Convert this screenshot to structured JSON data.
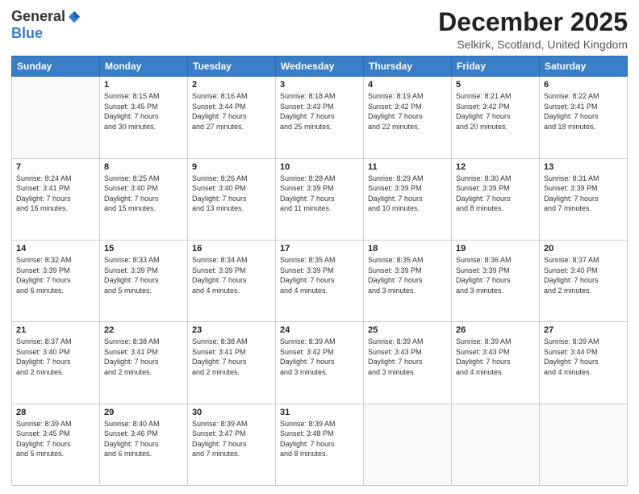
{
  "logo": {
    "general": "General",
    "blue": "Blue"
  },
  "header": {
    "month": "December 2025",
    "location": "Selkirk, Scotland, United Kingdom"
  },
  "weekdays": [
    "Sunday",
    "Monday",
    "Tuesday",
    "Wednesday",
    "Thursday",
    "Friday",
    "Saturday"
  ],
  "weeks": [
    [
      {
        "day": "",
        "info": ""
      },
      {
        "day": "1",
        "info": "Sunrise: 8:15 AM\nSunset: 3:45 PM\nDaylight: 7 hours\nand 30 minutes."
      },
      {
        "day": "2",
        "info": "Sunrise: 8:16 AM\nSunset: 3:44 PM\nDaylight: 7 hours\nand 27 minutes."
      },
      {
        "day": "3",
        "info": "Sunrise: 8:18 AM\nSunset: 3:43 PM\nDaylight: 7 hours\nand 25 minutes."
      },
      {
        "day": "4",
        "info": "Sunrise: 8:19 AM\nSunset: 3:42 PM\nDaylight: 7 hours\nand 22 minutes."
      },
      {
        "day": "5",
        "info": "Sunrise: 8:21 AM\nSunset: 3:42 PM\nDaylight: 7 hours\nand 20 minutes."
      },
      {
        "day": "6",
        "info": "Sunrise: 8:22 AM\nSunset: 3:41 PM\nDaylight: 7 hours\nand 18 minutes."
      }
    ],
    [
      {
        "day": "7",
        "info": "Sunrise: 8:24 AM\nSunset: 3:41 PM\nDaylight: 7 hours\nand 16 minutes."
      },
      {
        "day": "8",
        "info": "Sunrise: 8:25 AM\nSunset: 3:40 PM\nDaylight: 7 hours\nand 15 minutes."
      },
      {
        "day": "9",
        "info": "Sunrise: 8:26 AM\nSunset: 3:40 PM\nDaylight: 7 hours\nand 13 minutes."
      },
      {
        "day": "10",
        "info": "Sunrise: 8:28 AM\nSunset: 3:39 PM\nDaylight: 7 hours\nand 11 minutes."
      },
      {
        "day": "11",
        "info": "Sunrise: 8:29 AM\nSunset: 3:39 PM\nDaylight: 7 hours\nand 10 minutes."
      },
      {
        "day": "12",
        "info": "Sunrise: 8:30 AM\nSunset: 3:39 PM\nDaylight: 7 hours\nand 8 minutes."
      },
      {
        "day": "13",
        "info": "Sunrise: 8:31 AM\nSunset: 3:39 PM\nDaylight: 7 hours\nand 7 minutes."
      }
    ],
    [
      {
        "day": "14",
        "info": "Sunrise: 8:32 AM\nSunset: 3:39 PM\nDaylight: 7 hours\nand 6 minutes."
      },
      {
        "day": "15",
        "info": "Sunrise: 8:33 AM\nSunset: 3:39 PM\nDaylight: 7 hours\nand 5 minutes."
      },
      {
        "day": "16",
        "info": "Sunrise: 8:34 AM\nSunset: 3:39 PM\nDaylight: 7 hours\nand 4 minutes."
      },
      {
        "day": "17",
        "info": "Sunrise: 8:35 AM\nSunset: 3:39 PM\nDaylight: 7 hours\nand 4 minutes."
      },
      {
        "day": "18",
        "info": "Sunrise: 8:35 AM\nSunset: 3:39 PM\nDaylight: 7 hours\nand 3 minutes."
      },
      {
        "day": "19",
        "info": "Sunrise: 8:36 AM\nSunset: 3:39 PM\nDaylight: 7 hours\nand 3 minutes."
      },
      {
        "day": "20",
        "info": "Sunrise: 8:37 AM\nSunset: 3:40 PM\nDaylight: 7 hours\nand 2 minutes."
      }
    ],
    [
      {
        "day": "21",
        "info": "Sunrise: 8:37 AM\nSunset: 3:40 PM\nDaylight: 7 hours\nand 2 minutes."
      },
      {
        "day": "22",
        "info": "Sunrise: 8:38 AM\nSunset: 3:41 PM\nDaylight: 7 hours\nand 2 minutes."
      },
      {
        "day": "23",
        "info": "Sunrise: 8:38 AM\nSunset: 3:41 PM\nDaylight: 7 hours\nand 2 minutes."
      },
      {
        "day": "24",
        "info": "Sunrise: 8:39 AM\nSunset: 3:42 PM\nDaylight: 7 hours\nand 3 minutes."
      },
      {
        "day": "25",
        "info": "Sunrise: 8:39 AM\nSunset: 3:43 PM\nDaylight: 7 hours\nand 3 minutes."
      },
      {
        "day": "26",
        "info": "Sunrise: 8:39 AM\nSunset: 3:43 PM\nDaylight: 7 hours\nand 4 minutes."
      },
      {
        "day": "27",
        "info": "Sunrise: 8:39 AM\nSunset: 3:44 PM\nDaylight: 7 hours\nand 4 minutes."
      }
    ],
    [
      {
        "day": "28",
        "info": "Sunrise: 8:39 AM\nSunset: 3:45 PM\nDaylight: 7 hours\nand 5 minutes."
      },
      {
        "day": "29",
        "info": "Sunrise: 8:40 AM\nSunset: 3:46 PM\nDaylight: 7 hours\nand 6 minutes."
      },
      {
        "day": "30",
        "info": "Sunrise: 8:39 AM\nSunset: 3:47 PM\nDaylight: 7 hours\nand 7 minutes."
      },
      {
        "day": "31",
        "info": "Sunrise: 8:39 AM\nSunset: 3:48 PM\nDaylight: 7 hours\nand 8 minutes."
      },
      {
        "day": "",
        "info": ""
      },
      {
        "day": "",
        "info": ""
      },
      {
        "day": "",
        "info": ""
      }
    ]
  ]
}
